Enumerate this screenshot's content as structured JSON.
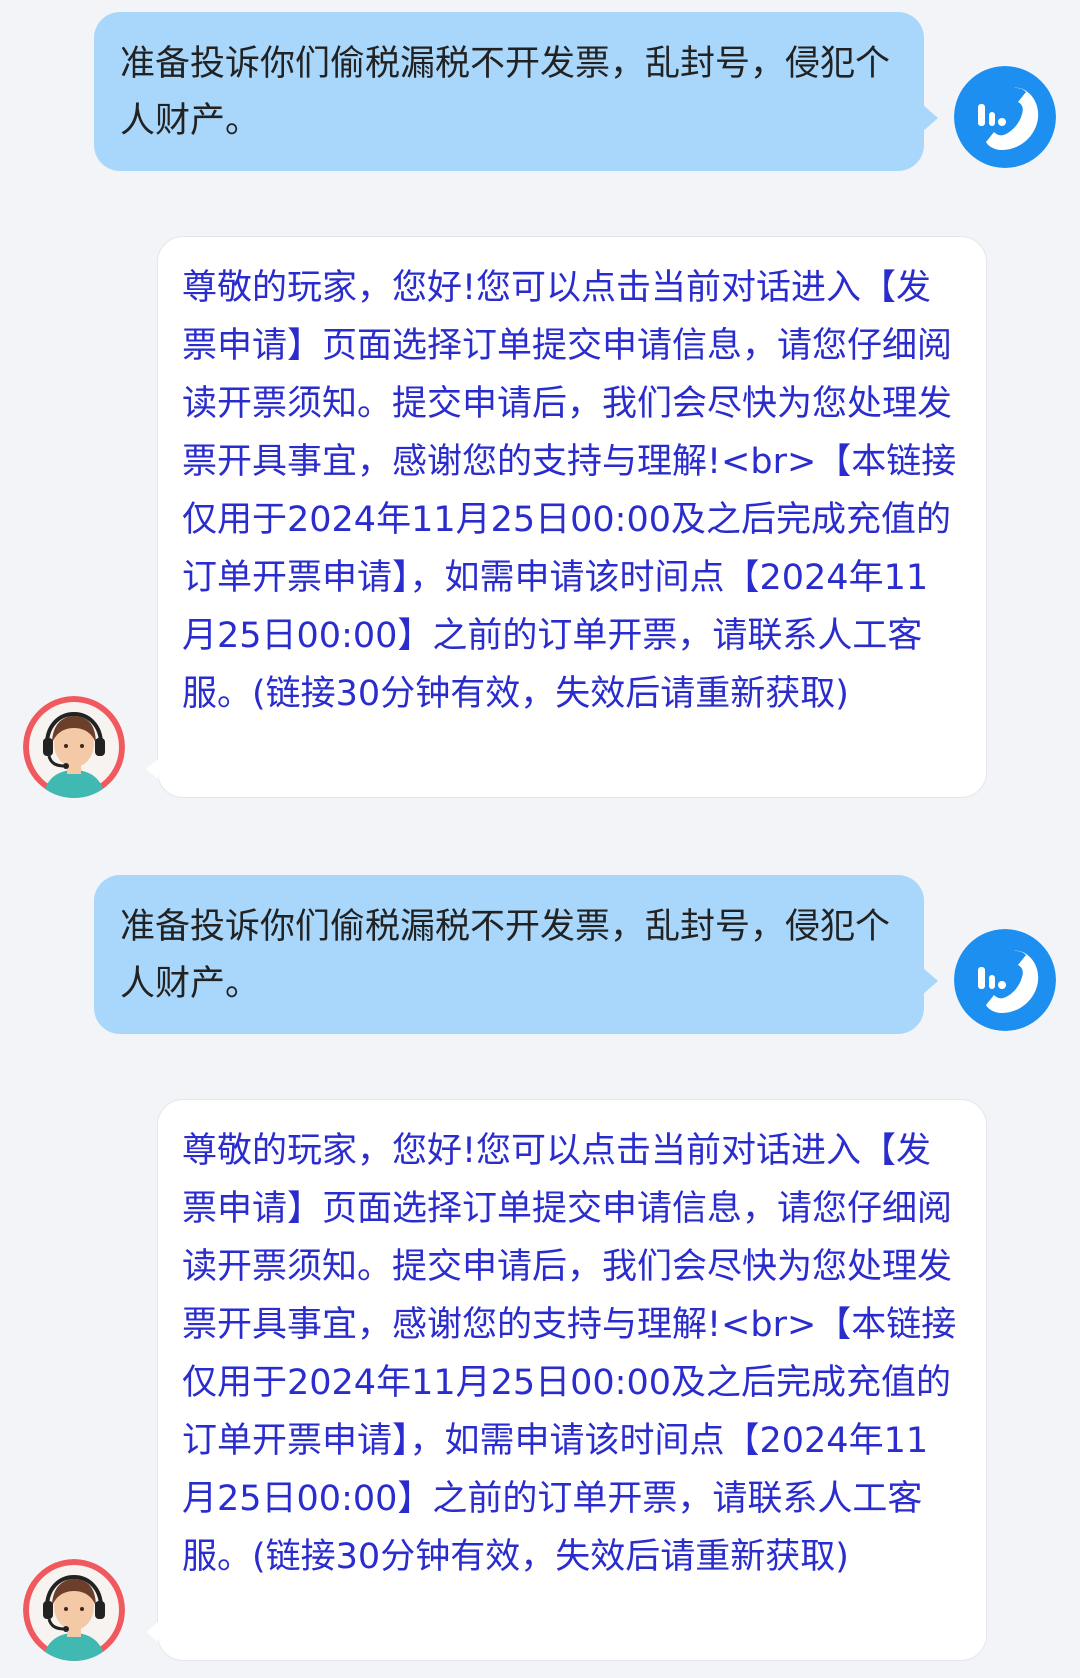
{
  "messages": [
    {
      "role": "user",
      "avatar_icon": "phone-app-icon",
      "text": "准备投诉你们偷税漏税不开发票，乱封号，侵犯个人财产。"
    },
    {
      "role": "agent",
      "avatar_icon": "customer-service-agent-icon",
      "text": "尊敬的玩家，您好!您可以点击当前对话进入【发票申请】页面选择订单提交申请信息，请您仔细阅读开票须知。提交申请后，我们会尽快为您处理发票开具事宜，感谢您的支持与理解!<br>【本链接仅用于2024年11月25日00:00及之后完成充值的订单开票申请】，如需申请该时间点【2024年11月25日00:00】之前的订单开票，请联系人工客服。(链接30分钟有效，失效后请重新获取)"
    },
    {
      "role": "user",
      "avatar_icon": "phone-app-icon",
      "text": "准备投诉你们偷税漏税不开发票，乱封号，侵犯个人财产。"
    },
    {
      "role": "agent",
      "avatar_icon": "customer-service-agent-icon",
      "text": "尊敬的玩家，您好!您可以点击当前对话进入【发票申请】页面选择订单提交申请信息，请您仔细阅读开票须知。提交申请后，我们会尽快为您处理发票开具事宜，感谢您的支持与理解!<br>【本链接仅用于2024年11月25日00:00及之后完成充值的订单开票申请】，如需申请该时间点【2024年11月25日00:00】之前的订单开票，请联系人工客服。(链接30分钟有效，失效后请重新获取)"
    }
  ],
  "colors": {
    "background": "#f2f4f7",
    "user_bubble": "#a9d7fb",
    "user_text": "#222222",
    "agent_bubble": "#ffffff",
    "agent_text": "#2a2ccd",
    "user_avatar": "#1d8ff0",
    "agent_avatar_ring": "#f05a5e"
  }
}
